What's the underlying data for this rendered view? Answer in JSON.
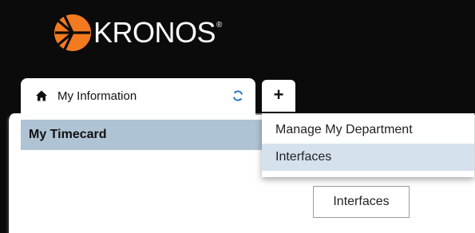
{
  "logo": {
    "text": "KRONOS",
    "registered": "®",
    "brand_color": "#f47a20"
  },
  "tabs": {
    "active": {
      "label": "My Information",
      "icon": "home-icon",
      "action_icon": "refresh-icon"
    },
    "add": {
      "label": "+",
      "icon": "plus-icon"
    }
  },
  "widget": {
    "title": "My Timecard",
    "header_color": "#aec3d4"
  },
  "dropdown": {
    "items": [
      {
        "label": "Manage My Department",
        "highlighted": false
      },
      {
        "label": "Interfaces",
        "highlighted": true
      }
    ],
    "highlight_color": "#d5e2ee"
  },
  "tooltip": {
    "text": "Interfaces"
  }
}
